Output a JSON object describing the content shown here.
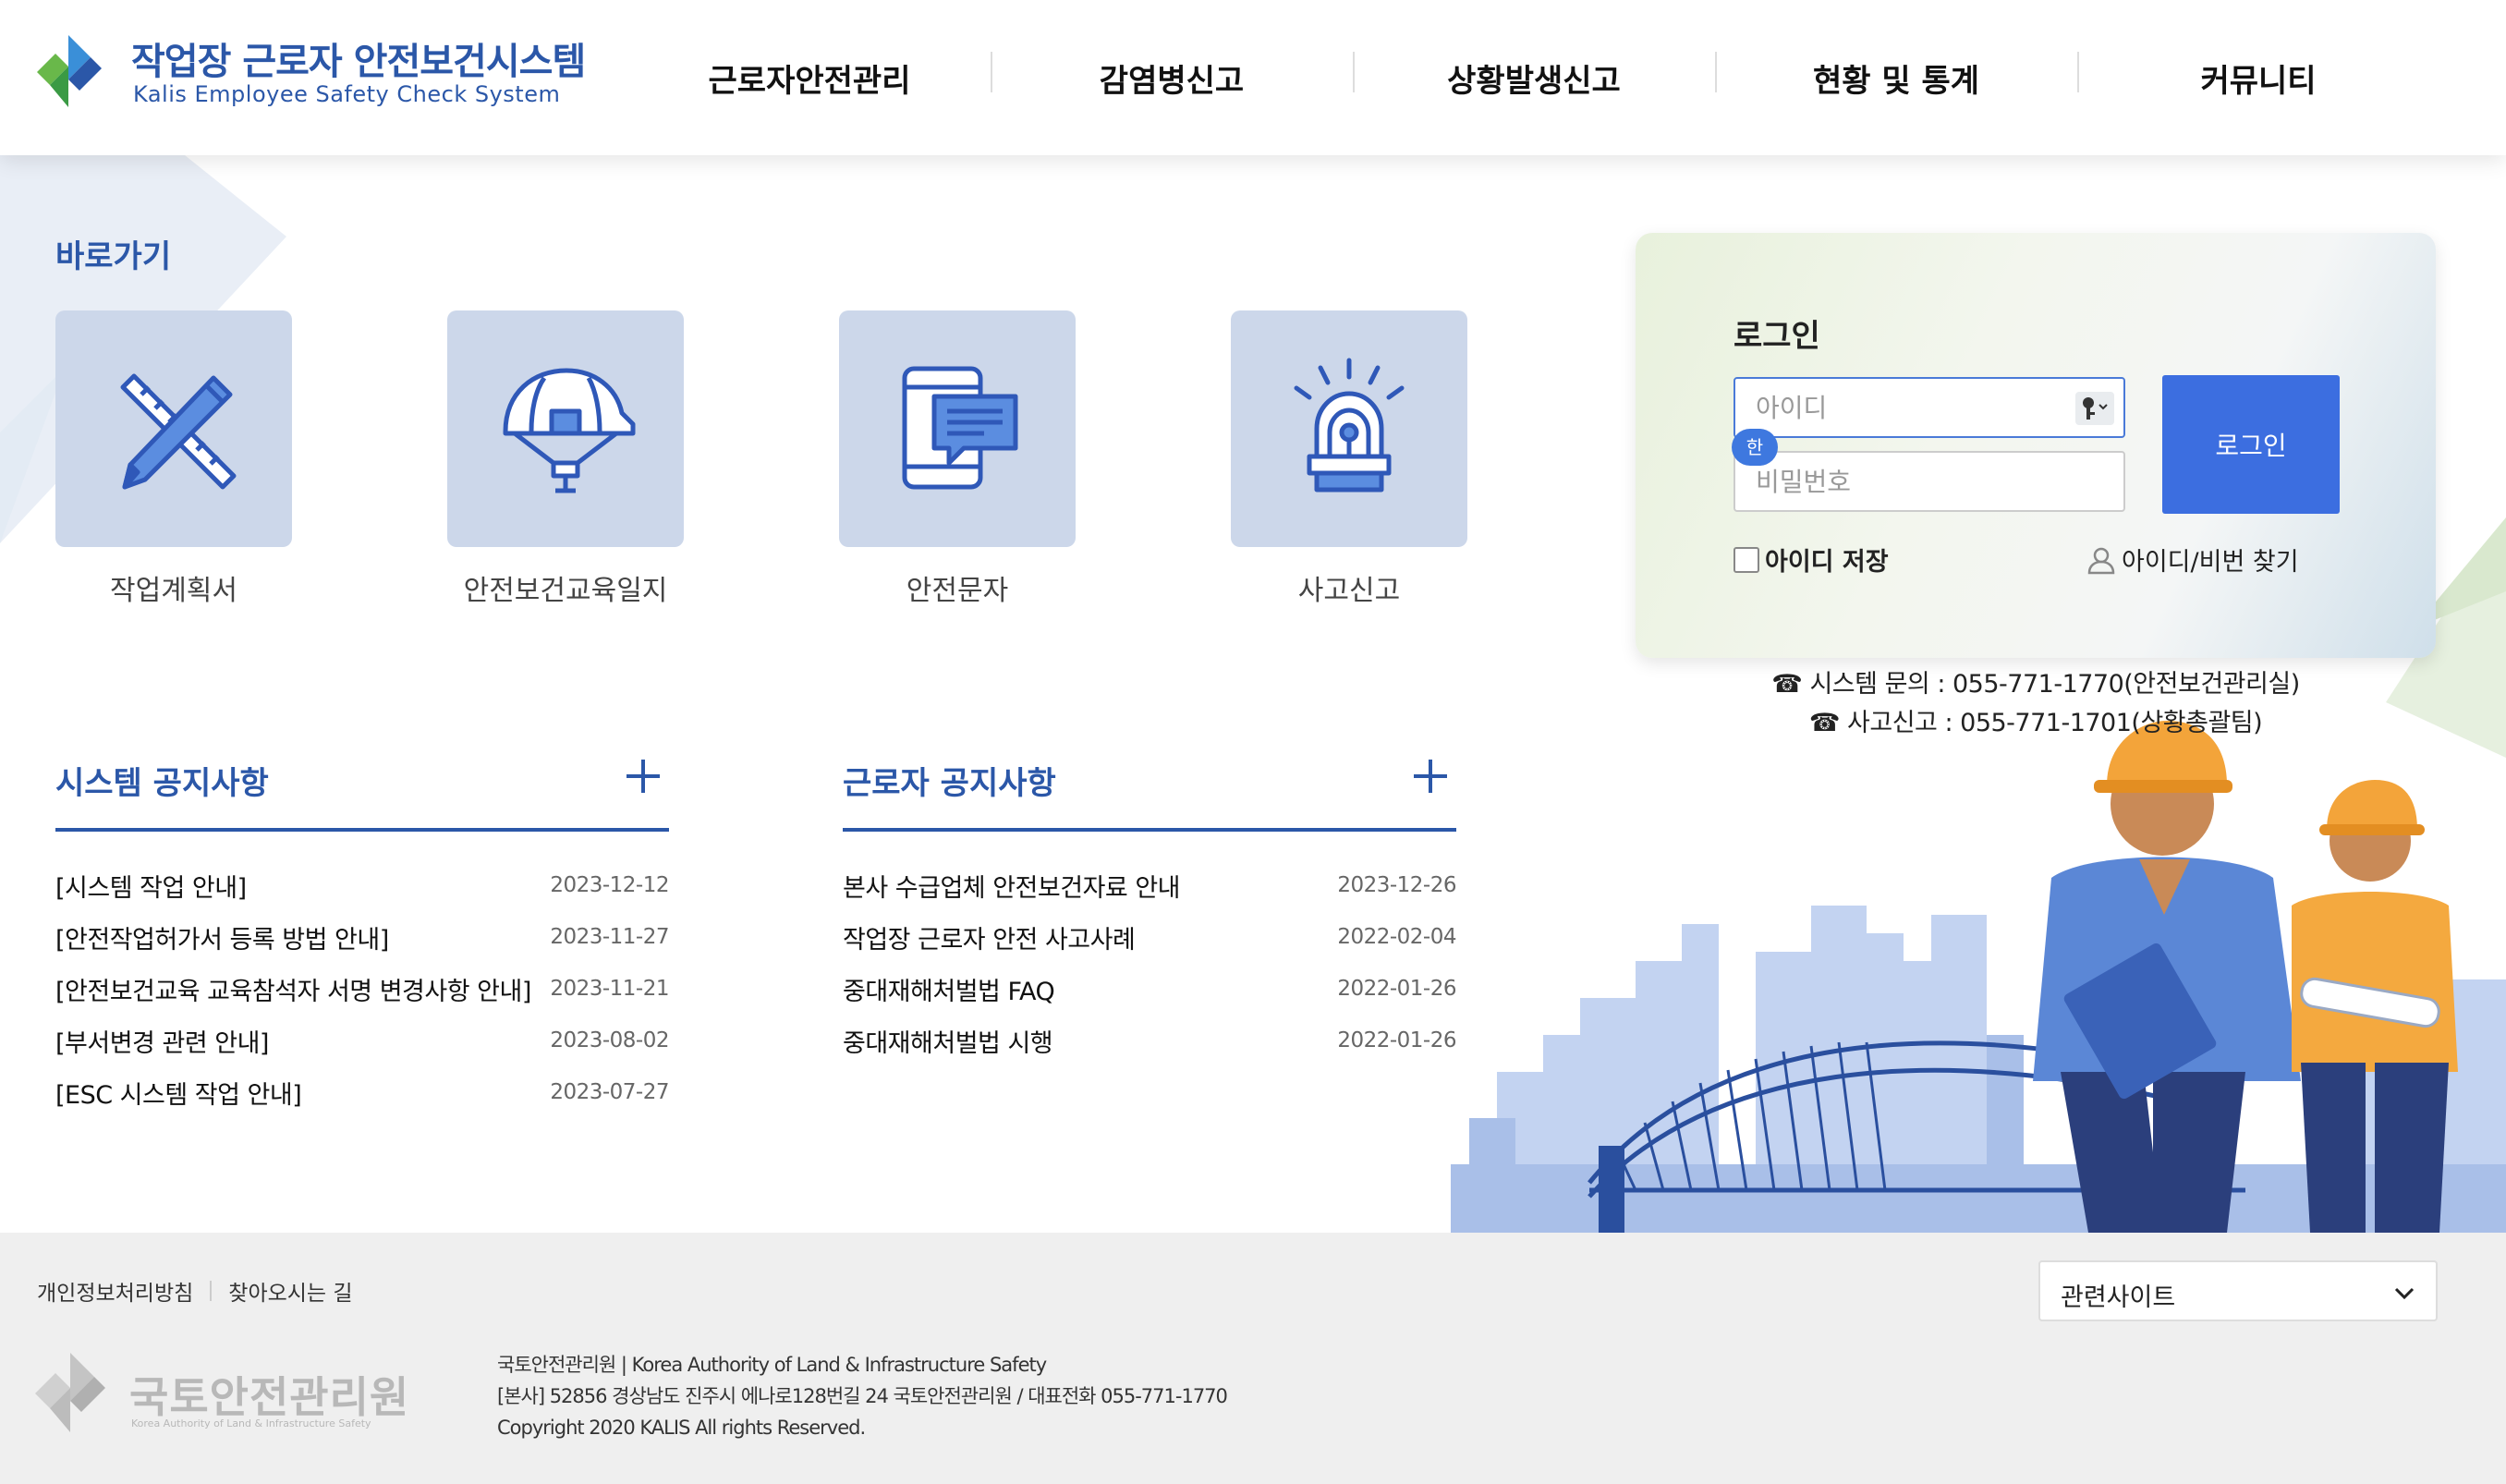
{
  "header": {
    "title": "작업장 근로자 안전보건시스템",
    "subtitle": "Kalis Employee Safety Check System",
    "nav": [
      "근로자안전관리",
      "감염병신고",
      "상황발생신고",
      "현황 및 통계",
      "커뮤니티"
    ]
  },
  "shortcuts": {
    "title": "바로가기",
    "items": [
      {
        "label": "작업계획서",
        "icon": "ruler-pencil-icon"
      },
      {
        "label": "안전보건교육일지",
        "icon": "hard-hat-icon"
      },
      {
        "label": "안전문자",
        "icon": "phone-message-icon"
      },
      {
        "label": "사고신고",
        "icon": "siren-icon"
      }
    ]
  },
  "system_notice": {
    "title": "시스템 공지사항",
    "items": [
      {
        "text": "[시스템 작업 안내]",
        "date": "2023-12-12"
      },
      {
        "text": "[안전작업허가서 등록 방법 안내]",
        "date": "2023-11-27"
      },
      {
        "text": "[안전보건교육 교육참석자 서명 변경사항 안내]",
        "date": "2023-11-21"
      },
      {
        "text": "[부서변경 관련 안내]",
        "date": "2023-08-02"
      },
      {
        "text": "[ESC 시스템 작업 안내]",
        "date": "2023-07-27"
      }
    ]
  },
  "worker_notice": {
    "title": "근로자 공지사항",
    "items": [
      {
        "text": "본사 수급업체 안전보건자료 안내",
        "date": "2023-12-26"
      },
      {
        "text": "작업장 근로자 안전 사고사례",
        "date": "2022-02-04"
      },
      {
        "text": "중대재해처벌법 FAQ",
        "date": "2022-01-26"
      },
      {
        "text": "중대재해처벌법 시행",
        "date": "2022-01-26"
      }
    ]
  },
  "login": {
    "title": "로그인",
    "id_placeholder": "아이디",
    "ime_badge": "한",
    "pw_placeholder": "비밀번호",
    "button": "로그인",
    "save_id": "아이디 저장",
    "find": "아이디/비번 찾기",
    "accent_color": "#3c6ee0"
  },
  "contact": {
    "system": "☎ 시스템 문의 : 055-771-1770(안전보건관리실)",
    "accident": "☎ 사고신고 : 055-771-1701(상황총괄팀)"
  },
  "footer": {
    "links": [
      "개인정보처리방침",
      "찾아오시는 길"
    ],
    "related_sites": "관련사이트",
    "org_name": "국토안전관리원",
    "org_sub": "Korea Authority of Land & Infrastructure Safety",
    "info": [
      "국토안전관리원 | Korea Authority of Land & Infrastructure Safety",
      "[본사] 52856 경상남도 진주시 에나로128번길 24 국토안전관리원 / 대표전화 055-771-1770",
      "Copyright 2020 KALIS All rights Reserved."
    ]
  },
  "colors": {
    "brand": "#2b57a8",
    "tile": "#ccd7ea",
    "icon_stroke": "#2f58b8"
  }
}
